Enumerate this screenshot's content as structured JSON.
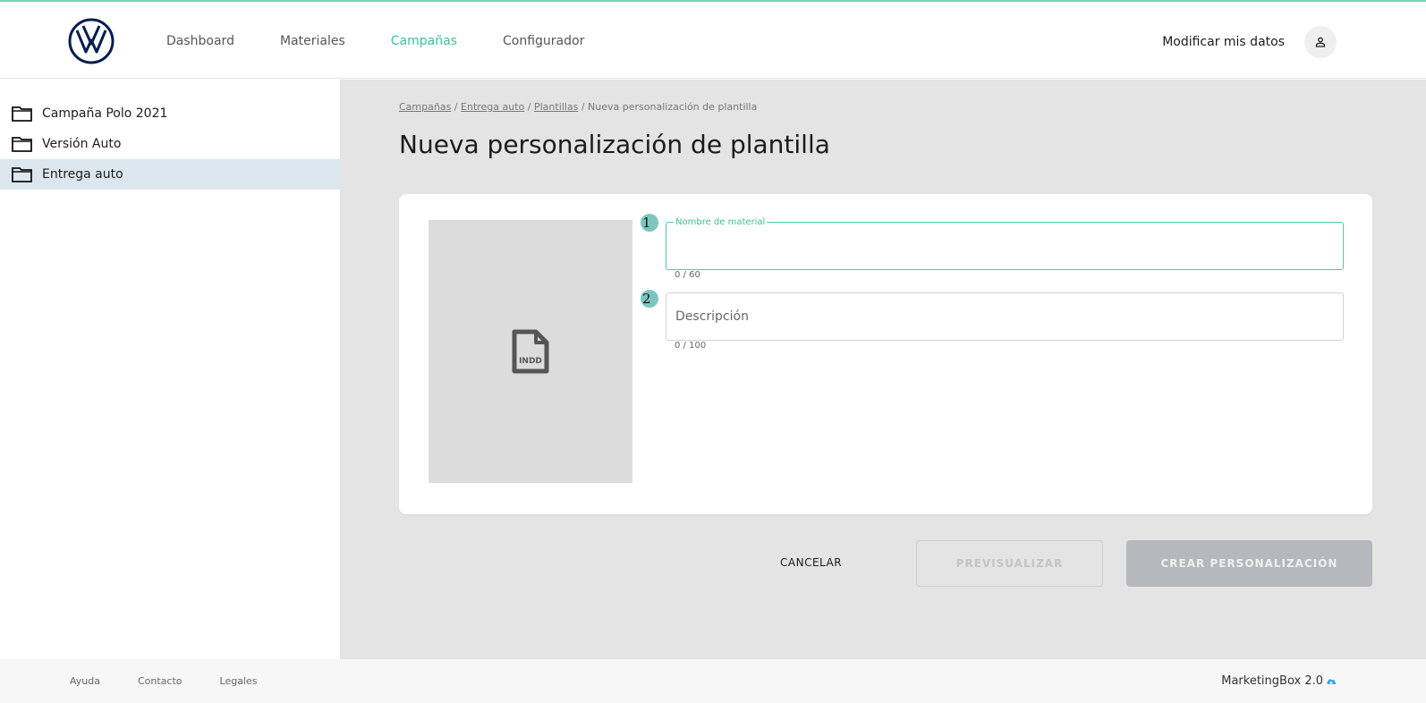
{
  "colors": {
    "accent": "#3cc29a",
    "top_line": "#6fd3b5",
    "brand_blue": "#001e50",
    "sidebar_active": "#dce6ee",
    "main_bg": "#e4e4e4",
    "step_badge": "#7ec5c0",
    "cloud_icon": "#2ba8e0"
  },
  "header": {
    "logo_icon": "vw-logo",
    "nav": [
      "Dashboard",
      "Materiales",
      "Campañas",
      "Configurador"
    ],
    "active_nav": "Campañas",
    "user_label": "Modificar mis datos",
    "user_icon": "person-icon"
  },
  "sidebar": {
    "items": [
      {
        "label": "Campaña Polo 2021",
        "icon": "folder-icon",
        "active": false
      },
      {
        "label": "Versión Auto",
        "icon": "folder-icon",
        "active": false
      },
      {
        "label": "Entrega auto",
        "icon": "folder-icon",
        "active": true
      }
    ]
  },
  "breadcrumb": {
    "links": [
      "Campañas",
      "Entrega auto",
      "Plantillas"
    ],
    "separator": " / ",
    "current": "Nueva personalización de plantilla"
  },
  "page": {
    "title": "Nueva personalización de plantilla"
  },
  "form": {
    "preview_icon": "indd-file-icon",
    "preview_label": "INDD",
    "fields": [
      {
        "step": "1",
        "label": "Nombre de material",
        "value": "",
        "counter": "0 / 60",
        "focused": true
      },
      {
        "step": "2",
        "placeholder": "Descripción",
        "value": "",
        "counter": "0 / 100",
        "focused": false
      }
    ]
  },
  "actions": {
    "cancel": "CANCELAR",
    "preview": "PREVISUALIZAR",
    "create": "CREAR PERSONALIZACIÓN"
  },
  "footer": {
    "links": [
      "Ayuda",
      "Contacto",
      "Legales"
    ],
    "brand": "MarketingBox 2.0",
    "brand_icon": "cloud-upload-icon"
  }
}
